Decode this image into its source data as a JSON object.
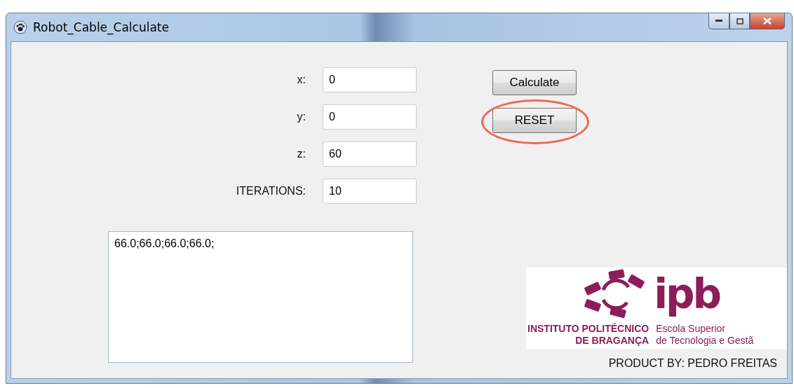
{
  "window": {
    "title": "Robot_Cable_Calculate"
  },
  "fields": [
    {
      "label": "x:",
      "value": "0"
    },
    {
      "label": "y:",
      "value": "0"
    },
    {
      "label": "z:",
      "value": "60"
    },
    {
      "label": "ITERATIONS:",
      "value": "10"
    }
  ],
  "buttons": [
    {
      "label": "Calculate",
      "highlighted": false
    },
    {
      "label": "RESET",
      "highlighted": true
    }
  ],
  "output": {
    "value": "66.0;66.0;66.0;66.0;\n"
  },
  "logo": {
    "mark": "ipb",
    "name_line_1": "INSTITUTO POLITÉCNICO",
    "name_line_2": "DE BRAGANÇA",
    "school_line_1": "Escola Superior",
    "school_line_2": "de Tecnologia e Gestã"
  },
  "footer": "PRODUCT BY: PEDRO FREITAS"
}
